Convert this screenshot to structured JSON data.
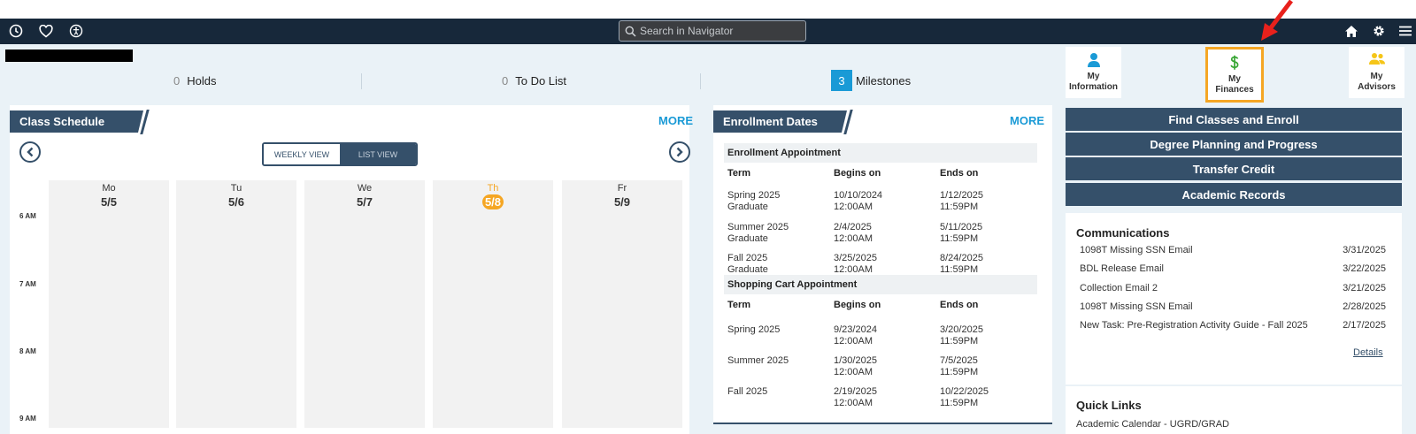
{
  "topbar": {
    "search_placeholder": "Search in Navigator",
    "left_icons": [
      "clock-icon",
      "heart-icon",
      "accessibility-icon"
    ],
    "right_icons": [
      "home-icon",
      "gear-icon",
      "menu-icon"
    ]
  },
  "stats": {
    "holds": {
      "count": "0",
      "label": "Holds"
    },
    "todo": {
      "count": "0",
      "label": "To Do List"
    },
    "milestones": {
      "count": "3",
      "label": "Milestones"
    }
  },
  "tiles": {
    "info": {
      "line1": "My",
      "line2": "Information"
    },
    "finances": {
      "line1": "My",
      "line2": "Finances"
    },
    "advisors": {
      "line1": "My",
      "line2": "Advisors"
    }
  },
  "schedule": {
    "title": "Class Schedule",
    "more": "MORE",
    "weekly_view": "WEEKLY VIEW",
    "list_view": "LIST VIEW",
    "days": [
      {
        "name": "Mo",
        "date": "5/5"
      },
      {
        "name": "Tu",
        "date": "5/6"
      },
      {
        "name": "We",
        "date": "5/7"
      },
      {
        "name": "Th",
        "date": "5/8"
      },
      {
        "name": "Fr",
        "date": "5/9"
      }
    ],
    "hours": [
      "6 AM",
      "7 AM",
      "8 AM",
      "9 AM"
    ]
  },
  "enrollment": {
    "title": "Enrollment Dates",
    "more": "MORE",
    "section1": "Enrollment Appointment",
    "section2": "Shopping Cart Appointment",
    "col_term": "Term",
    "col_begins": "Begins on",
    "col_ends": "Ends on",
    "appointments": [
      {
        "term": "Spring 2025",
        "career": "Graduate",
        "begin_date": "10/10/2024",
        "begin_time": "12:00AM",
        "end_date": "1/12/2025",
        "end_time": "11:59PM"
      },
      {
        "term": "Summer 2025",
        "career": "Graduate",
        "begin_date": "2/4/2025",
        "begin_time": "12:00AM",
        "end_date": "5/11/2025",
        "end_time": "11:59PM"
      },
      {
        "term": "Fall 2025",
        "career": "Graduate",
        "begin_date": "3/25/2025",
        "begin_time": "12:00AM",
        "end_date": "8/24/2025",
        "end_time": "11:59PM"
      }
    ],
    "cart": [
      {
        "term": "Spring 2025",
        "begin_date": "9/23/2024",
        "begin_time": "12:00AM",
        "end_date": "3/20/2025",
        "end_time": "11:59PM"
      },
      {
        "term": "Summer 2025",
        "begin_date": "1/30/2025",
        "begin_time": "12:00AM",
        "end_date": "7/5/2025",
        "end_time": "11:59PM"
      },
      {
        "term": "Fall 2025",
        "begin_date": "2/19/2025",
        "begin_time": "12:00AM",
        "end_date": "10/22/2025",
        "end_time": "11:59PM"
      }
    ]
  },
  "nav_buttons": [
    "Find Classes and Enroll",
    "Degree Planning and Progress",
    "Transfer Credit",
    "Academic Records"
  ],
  "communications": {
    "title": "Communications",
    "items": [
      {
        "subject": "1098T Missing SSN Email",
        "date": "3/31/2025"
      },
      {
        "subject": "BDL Release Email",
        "date": "3/22/2025"
      },
      {
        "subject": "Collection Email 2",
        "date": "3/21/2025"
      },
      {
        "subject": "1098T Missing SSN Email",
        "date": "2/28/2025"
      },
      {
        "subject": "New Task: Pre-Registration Activity Guide - Fall 2025",
        "date": "2/17/2025"
      }
    ],
    "details": "Details"
  },
  "quick_links": {
    "title": "Quick Links",
    "items": [
      "Academic Calendar - UGRD/GRAD"
    ]
  },
  "colors": {
    "navy": "#35506a",
    "accent": "#1a9ad6",
    "highlight": "#f5a623",
    "arrow": "#e8211c"
  }
}
